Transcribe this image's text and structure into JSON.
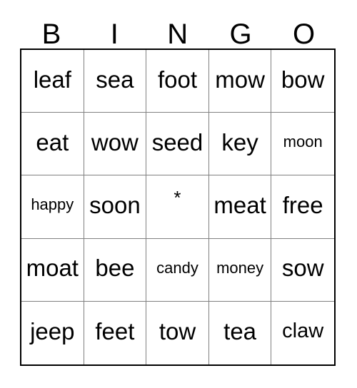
{
  "card": {
    "header": {
      "letters": [
        "B",
        "I",
        "N",
        "G",
        "O"
      ]
    },
    "grid": {
      "columns": 5,
      "rows": 5,
      "free_space_marker": "*",
      "cells": [
        {
          "text": "leaf",
          "size": "lg"
        },
        {
          "text": "sea",
          "size": "lg"
        },
        {
          "text": "foot",
          "size": "lg"
        },
        {
          "text": "mow",
          "size": "lg"
        },
        {
          "text": "bow",
          "size": "lg"
        },
        {
          "text": "eat",
          "size": "lg"
        },
        {
          "text": "wow",
          "size": "lg"
        },
        {
          "text": "seed",
          "size": "lg"
        },
        {
          "text": "key",
          "size": "lg"
        },
        {
          "text": "moon",
          "size": "sm"
        },
        {
          "text": "happy",
          "size": "sm"
        },
        {
          "text": "soon",
          "size": "lg"
        },
        {
          "text": "*",
          "size": "free"
        },
        {
          "text": "meat",
          "size": "lg"
        },
        {
          "text": "free",
          "size": "lg"
        },
        {
          "text": "moat",
          "size": "lg"
        },
        {
          "text": "bee",
          "size": "lg"
        },
        {
          "text": "candy",
          "size": "sm"
        },
        {
          "text": "money",
          "size": "sm"
        },
        {
          "text": "sow",
          "size": "lg"
        },
        {
          "text": "jeep",
          "size": "lg"
        },
        {
          "text": "feet",
          "size": "lg"
        },
        {
          "text": "tow",
          "size": "lg"
        },
        {
          "text": "tea",
          "size": "lg"
        },
        {
          "text": "claw",
          "size": "md"
        }
      ]
    },
    "colors": {
      "background": "#ffffff",
      "text": "#000000",
      "outer_border": "#000000",
      "inner_gridline": "#808080"
    }
  }
}
